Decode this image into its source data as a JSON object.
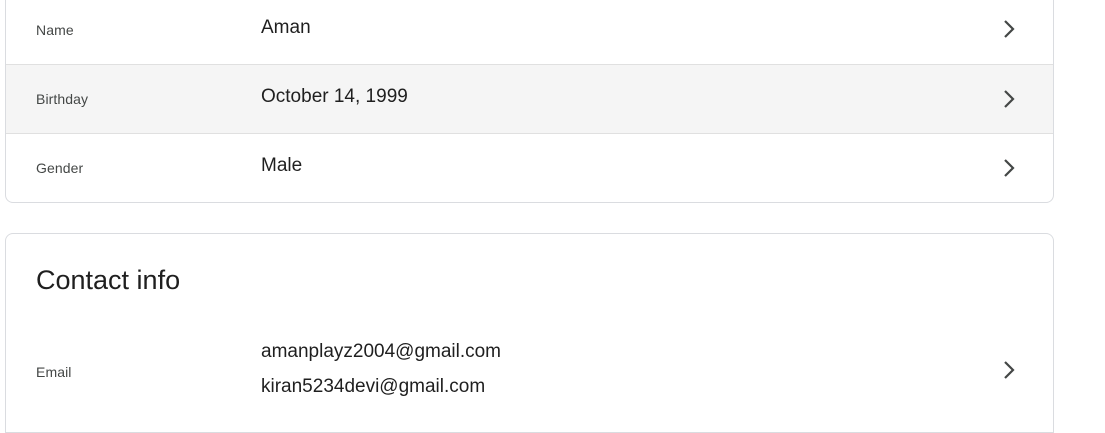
{
  "basic_info": {
    "rows": [
      {
        "label": "Name",
        "value": "Aman"
      },
      {
        "label": "Birthday",
        "value": "October 14, 1999"
      },
      {
        "label": "Gender",
        "value": "Male"
      }
    ]
  },
  "contact_info": {
    "title": "Contact info",
    "email": {
      "label": "Email",
      "values": [
        "amanplayz2004@gmail.com",
        "kiran5234devi@gmail.com"
      ]
    }
  },
  "icons": {
    "row_chevron": "chevron-right-icon"
  },
  "colors": {
    "hover_row_background": "#f5f5f5",
    "border": "#dadce0",
    "text_primary": "#1f1f1f",
    "text_secondary": "#444746"
  }
}
